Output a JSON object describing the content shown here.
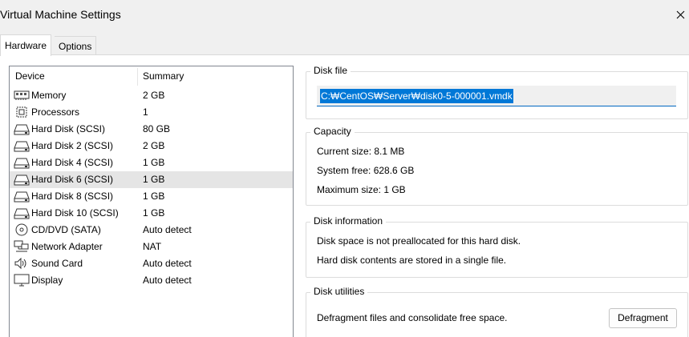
{
  "window": {
    "title": "Virtual Machine Settings"
  },
  "tabs": [
    {
      "label": "Hardware",
      "active": true
    },
    {
      "label": "Options",
      "active": false
    }
  ],
  "device_list": {
    "headers": {
      "device": "Device",
      "summary": "Summary"
    },
    "selected_index": 4,
    "rows": [
      {
        "device": "Memory",
        "summary": "2 GB",
        "icon": "memory-icon"
      },
      {
        "device": "Processors",
        "summary": "1",
        "icon": "processor-icon"
      },
      {
        "device": "Hard Disk (SCSI)",
        "summary": "80 GB",
        "icon": "hard-disk-icon"
      },
      {
        "device": "Hard Disk 2 (SCSI)",
        "summary": "2 GB",
        "icon": "hard-disk-icon"
      },
      {
        "device": "Hard Disk 4 (SCSI)",
        "summary": "1 GB",
        "icon": "hard-disk-icon"
      },
      {
        "device": "Hard Disk 6 (SCSI)",
        "summary": "1 GB",
        "icon": "hard-disk-icon"
      },
      {
        "device": "Hard Disk 8 (SCSI)",
        "summary": "1 GB",
        "icon": "hard-disk-icon"
      },
      {
        "device": "Hard Disk 10 (SCSI)",
        "summary": "1 GB",
        "icon": "hard-disk-icon"
      },
      {
        "device": "CD/DVD (SATA)",
        "summary": "Auto detect",
        "icon": "cd-dvd-icon"
      },
      {
        "device": "Network Adapter",
        "summary": "NAT",
        "icon": "network-adapter-icon"
      },
      {
        "device": "Sound Card",
        "summary": "Auto detect",
        "icon": "speaker-icon"
      },
      {
        "device": "Display",
        "summary": "Auto detect",
        "icon": "display-icon"
      }
    ]
  },
  "disk_file": {
    "label": "Disk file",
    "value": "C:\\CentOS\\Server\\disk0-5-000001.vmdk",
    "display_value": "C:₩CentOS₩Server₩disk0-5-000001.vmdk"
  },
  "capacity": {
    "label": "Capacity",
    "current_size": "Current size:  8.1 MB",
    "system_free": "System free:  628.6 GB",
    "maximum_size": "Maximum size:  1 GB"
  },
  "disk_information": {
    "label": "Disk information",
    "line1": "Disk space is not preallocated for this hard disk.",
    "line2": "Hard disk contents are stored in a single file."
  },
  "disk_utilities": {
    "label": "Disk utilities",
    "description": "Defragment files and consolidate free space.",
    "button_label": "Defragment"
  },
  "colors": {
    "selection_highlight": "#0078d7",
    "selected_row": "#e5e5e5",
    "background": "#f0f0f0"
  }
}
